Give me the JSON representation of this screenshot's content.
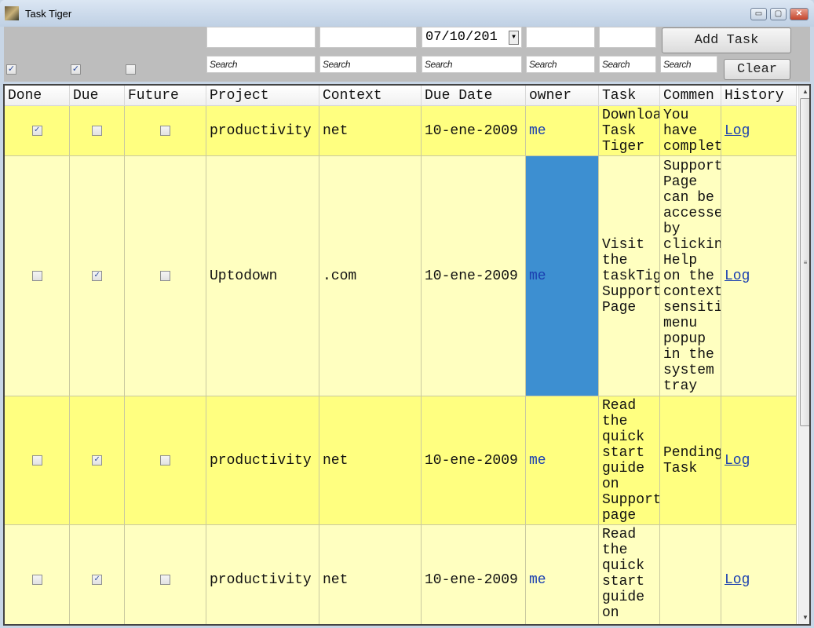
{
  "window": {
    "title": "Task Tiger",
    "minimize": "▭",
    "maximize": "▢",
    "close": "✕"
  },
  "toolbar": {
    "filters": {
      "done": true,
      "due": true,
      "future": false
    },
    "inputs": {
      "project": "",
      "context": "",
      "due_date": "07/10/201",
      "owner": "",
      "task": ""
    },
    "search_placeholder": "Search",
    "add_task": "Add Task",
    "clear": "Clear"
  },
  "grid": {
    "columns": [
      "Done",
      "Due",
      "Future",
      "Project",
      "Context",
      "Due Date",
      "owner",
      "Task",
      "Commen",
      "History"
    ],
    "rows": [
      {
        "done": true,
        "due": false,
        "future": false,
        "project": "productivity",
        "context": "net",
        "due_date": "10-ene-2009",
        "owner": "me",
        "task": "Download Task Tiger",
        "comments": "You have complet",
        "history": "Log"
      },
      {
        "done": false,
        "due": true,
        "future": false,
        "project": "Uptodown",
        "context": ".com",
        "due_date": "10-ene-2009",
        "owner": "me",
        "task": "Visit the taskTiger Support Page",
        "comments": "Support Page can be accessed by clicking Help on the context sensitive menu popup in the system tray",
        "history": "Log",
        "selected_cell": "owner"
      },
      {
        "done": false,
        "due": true,
        "future": false,
        "project": "productivity",
        "context": "net",
        "due_date": "10-ene-2009",
        "owner": "me",
        "task": "Read the quick start guide on Support page",
        "comments": "Pending Task",
        "history": "Log"
      },
      {
        "done": false,
        "due": true,
        "future": false,
        "project": "productivity",
        "context": "net",
        "due_date": "10-ene-2009",
        "owner": "me",
        "task": "Read the quick start guide on",
        "comments": "",
        "history": "Log"
      }
    ]
  },
  "colors": {
    "row_yellow": "#ffff80",
    "row_light": "#ffffc0",
    "selection": "#3d8fd1",
    "link": "#1a3fb0"
  }
}
